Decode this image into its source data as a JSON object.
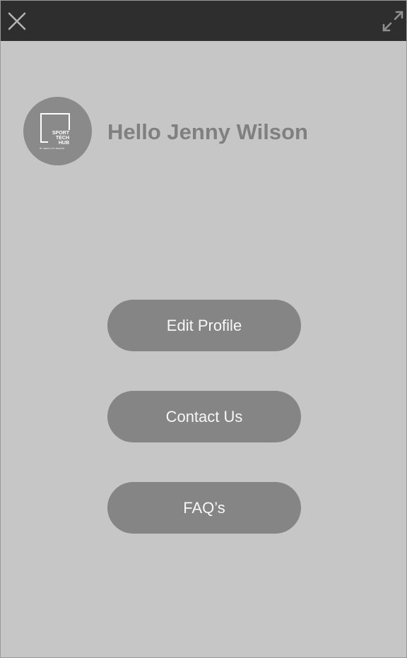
{
  "topbar": {
    "close_icon": "close-icon",
    "expand_icon": "expand-icon"
  },
  "profile": {
    "logo_lines": [
      "SPORT",
      "TECH",
      "HUB"
    ],
    "logo_tagline": "BY LEEDS CITY REGION",
    "greeting": "Hello Jenny Wilson"
  },
  "menu": {
    "edit_profile_label": "Edit Profile",
    "contact_us_label": "Contact Us",
    "faq_label": "FAQ’s"
  },
  "colors": {
    "background": "#c6c6c6",
    "topbar": "#2e2e2e",
    "button": "#858585",
    "greeting_text": "#808080"
  }
}
